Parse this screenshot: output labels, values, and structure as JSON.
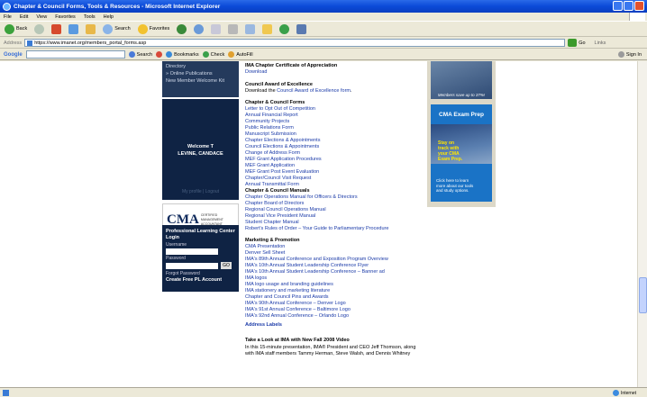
{
  "window": {
    "title": "Chapter & Council Forms, Tools & Resources - Microsoft Internet Explorer"
  },
  "menu": [
    "File",
    "Edit",
    "View",
    "Favorites",
    "Tools",
    "Help"
  ],
  "toolbar": {
    "back_label": "Back",
    "search_label": "Search",
    "favorites_label": "Favorites"
  },
  "address": {
    "label": "Address",
    "url": "https://www.imanet.org/members_portal_forms.asp",
    "go_label": "Go",
    "links_label": "Links"
  },
  "googlebar": {
    "logo": "Google",
    "search_label": "Search",
    "bookmarks_label": "Bookmarks",
    "check_label": "Check",
    "autofill_label": "AutoFill",
    "signin_label": "Sign In"
  },
  "left": {
    "nav": [
      "Directory",
      "» Online Publications",
      "New Member Welcome Kit"
    ],
    "welcome_line1": "Welcome T",
    "welcome_line2": "LEVINE, CANDACE",
    "welcome_line3": "My profile  |  Logout",
    "cma_logo": "CMA",
    "cma_tagline": "CERTIFIED MANAGEMENT ACCOUNTANT",
    "login": {
      "title": "Professional Learning Center Login",
      "username_label": "Username",
      "password_label": "Password",
      "go_label": "GO",
      "forgot_label": "Forgot Password",
      "create_label": "Create Free PL Account"
    }
  },
  "middle": {
    "certificate_heading": "IMA Chapter Certificate of Appreciation",
    "certificate_download": "Download",
    "award_heading": "Council Award of Excellence",
    "award_text_prefix": "Download the ",
    "award_link": "Council Award of Excellence form",
    "award_text_suffix": ".",
    "forms_heading": "Chapter & Council Forms",
    "forms": [
      "Letter to Opt Out of Competition",
      "Annual Financial Report",
      "Community Projects",
      "Public Relations Form",
      "Manuscript Submission",
      "Chapter Elections & Appointments",
      "Council Elections & Appointments",
      "Change of Address Form",
      "MEF Grant Application Procedures",
      "MEF Grant Application",
      "MEF Grant Post Event Evaluation",
      "Chapter/Council Visit Request",
      "Annual Transmittal Form"
    ],
    "manuals_heading": "Chapter & Council Manuals",
    "manuals": [
      "Chapter Operations Manual for Officers & Directors",
      "Chapter Board of Directors",
      "Regional Council Operations Manual",
      "Regional Vice President Manual",
      "Student Chapter Manual",
      "Robert's Rules of Order – Your Guide to Parliamentary Procedure"
    ],
    "marketing_heading": "Marketing & Promotion",
    "marketing": [
      "CMA Presentation",
      "Denver Sell Sheet",
      "IMA's 89th Annual Conference and Exposition Program Overview",
      "IMA's 10th Annual Student Leadership Conference Flyer",
      "IMA's 10th Annual Student Leadership Conference – Banner ad",
      "IMA logos",
      "IMA logo usage and branding guidelines",
      "IMA stationery and marketing literature",
      "Chapter and Council Pins and Awards",
      "IMA's 90th Annual Conference – Denver Logo",
      "IMA's 91st Annual Conference – Baltimore Logo",
      "IMA's 92nd Annual Conference – Orlando Logo"
    ],
    "address_labels": "Address Labels",
    "video_heading": "Take a Look at IMA with New Fall 2008 Video",
    "video_text1": "In this 15-minute presentation, IMA® President and CEO Jeff Thomson, along",
    "video_text2": "with IMA staff members Tammy Herman, Steve Walsh, and Dennis Whitney"
  },
  "right": {
    "top_caption": "Members save up to 37%!",
    "exam_heading": "CMA Exam Prep",
    "exam_stay": [
      "Stay on",
      "track with",
      "your CMA",
      "Exam Prep."
    ],
    "exam_more": [
      "Click here to learn",
      "more about our tools",
      "and study options."
    ]
  },
  "status": {
    "zone": "Internet"
  }
}
